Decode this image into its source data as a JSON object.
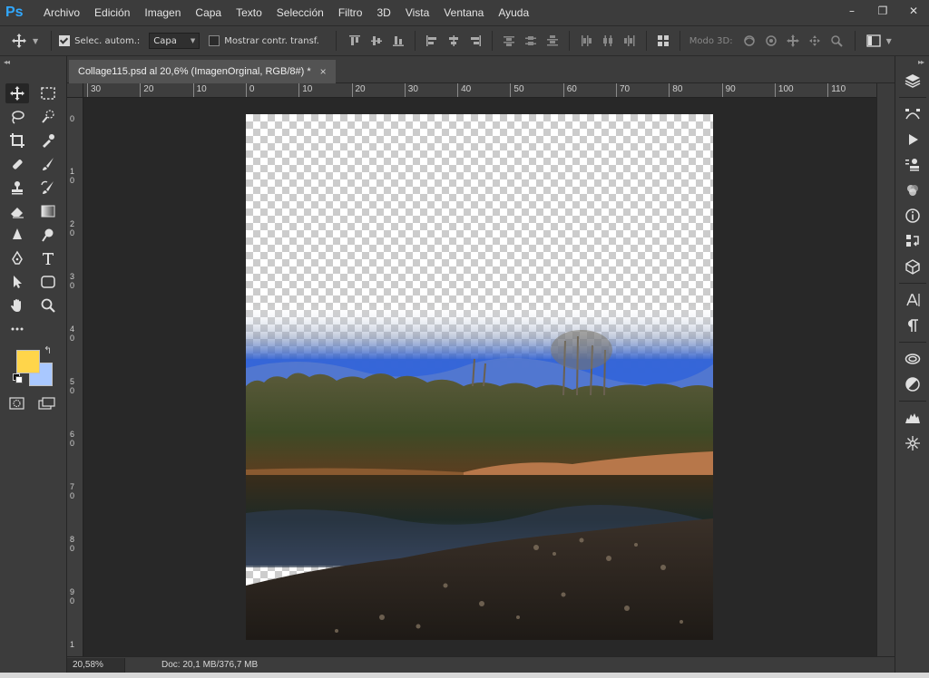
{
  "app": {
    "logo": "Ps"
  },
  "menu": [
    "Archivo",
    "Edición",
    "Imagen",
    "Capa",
    "Texto",
    "Selección",
    "Filtro",
    "3D",
    "Vista",
    "Ventana",
    "Ayuda"
  ],
  "window_controls": {
    "minimize": "–",
    "restore": "❐",
    "close": "✕"
  },
  "options_bar": {
    "auto_select_label": "Selec. autom.:",
    "auto_select_checked": true,
    "target_value": "Capa",
    "show_transform_label": "Mostrar contr. transf.",
    "show_transform_checked": false,
    "mode3d_label": "Modo 3D:"
  },
  "document": {
    "tab_title": "Collage115.psd al 20,6% (ImagenOrginal, RGB/8#) *",
    "close": "×"
  },
  "ruler": {
    "h_labels": [
      "30",
      "20",
      "10",
      "0",
      "10",
      "20",
      "30",
      "40",
      "50",
      "60",
      "70",
      "80",
      "90",
      "100",
      "110"
    ],
    "v_labels": [
      "0",
      "1\n0",
      "2\n0",
      "3\n0",
      "4\n0",
      "5\n0",
      "6\n0",
      "7\n0",
      "8\n0",
      "9\n0",
      "1"
    ]
  },
  "status": {
    "zoom": "20,58%",
    "doc_info": "Doc: 20,1 MB/376,7 MB",
    "arrow": "›"
  },
  "colors": {
    "foreground": "#ffd54a",
    "background": "#a9c8ff",
    "accent": "#31a8ff"
  },
  "tools": [
    "move-tool",
    "marquee-tool",
    "lasso-tool",
    "quick-select-tool",
    "crop-tool",
    "eyedropper-tool",
    "healing-brush-tool",
    "brush-tool",
    "clone-stamp-tool",
    "history-brush-tool",
    "eraser-tool",
    "gradient-tool",
    "blur-tool",
    "dodge-tool",
    "pen-tool",
    "type-tool",
    "path-select-tool",
    "shape-tool",
    "hand-tool",
    "zoom-tool"
  ],
  "right_panel_icons": [
    "layers-icon",
    "paths-icon",
    "actions-icon",
    "clone-source-icon",
    "color-icon",
    "info-icon",
    "history-icon",
    "3d-icon",
    "character-icon",
    "paragraph-icon",
    "libraries-icon",
    "adjustments-icon",
    "histogram-icon",
    "navigator-icon"
  ]
}
